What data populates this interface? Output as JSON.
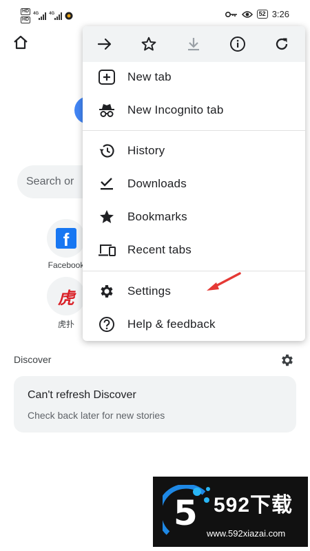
{
  "status_bar": {
    "time": "3:26",
    "battery": "52",
    "sim_tags": [
      "HD",
      "HD"
    ],
    "network_tags": [
      "4G",
      "4G"
    ]
  },
  "search": {
    "placeholder_partial": "Search or"
  },
  "shortcuts": [
    {
      "label": "Facebook"
    },
    {
      "label": "虎扑",
      "glyph": "虎"
    }
  ],
  "menu": {
    "toolbar_icons": [
      "forward-icon",
      "star-icon",
      "download-icon",
      "info-icon",
      "refresh-icon"
    ],
    "items": [
      {
        "label": "New tab",
        "icon": "new-tab-icon"
      },
      {
        "label": "New Incognito tab",
        "icon": "incognito-icon"
      },
      {
        "label": "History",
        "icon": "history-icon"
      },
      {
        "label": "Downloads",
        "icon": "downloads-icon"
      },
      {
        "label": "Bookmarks",
        "icon": "bookmarks-icon"
      },
      {
        "label": "Recent tabs",
        "icon": "recent-tabs-icon"
      },
      {
        "label": "Settings",
        "icon": "settings-icon"
      },
      {
        "label": "Help & feedback",
        "icon": "help-icon"
      }
    ]
  },
  "discover": {
    "label": "Discover",
    "card_title": "Can't refresh Discover",
    "card_subtitle": "Check back later for new stories"
  },
  "watermark": {
    "digit": "5",
    "title": "592下载",
    "url": "www.592xiazai.com"
  },
  "colors": {
    "accent_arrow": "#e53935",
    "menu_toolbar_bg": "#f1f3f4",
    "facebook_blue": "#1877f2",
    "hupu_red": "#d92027"
  }
}
